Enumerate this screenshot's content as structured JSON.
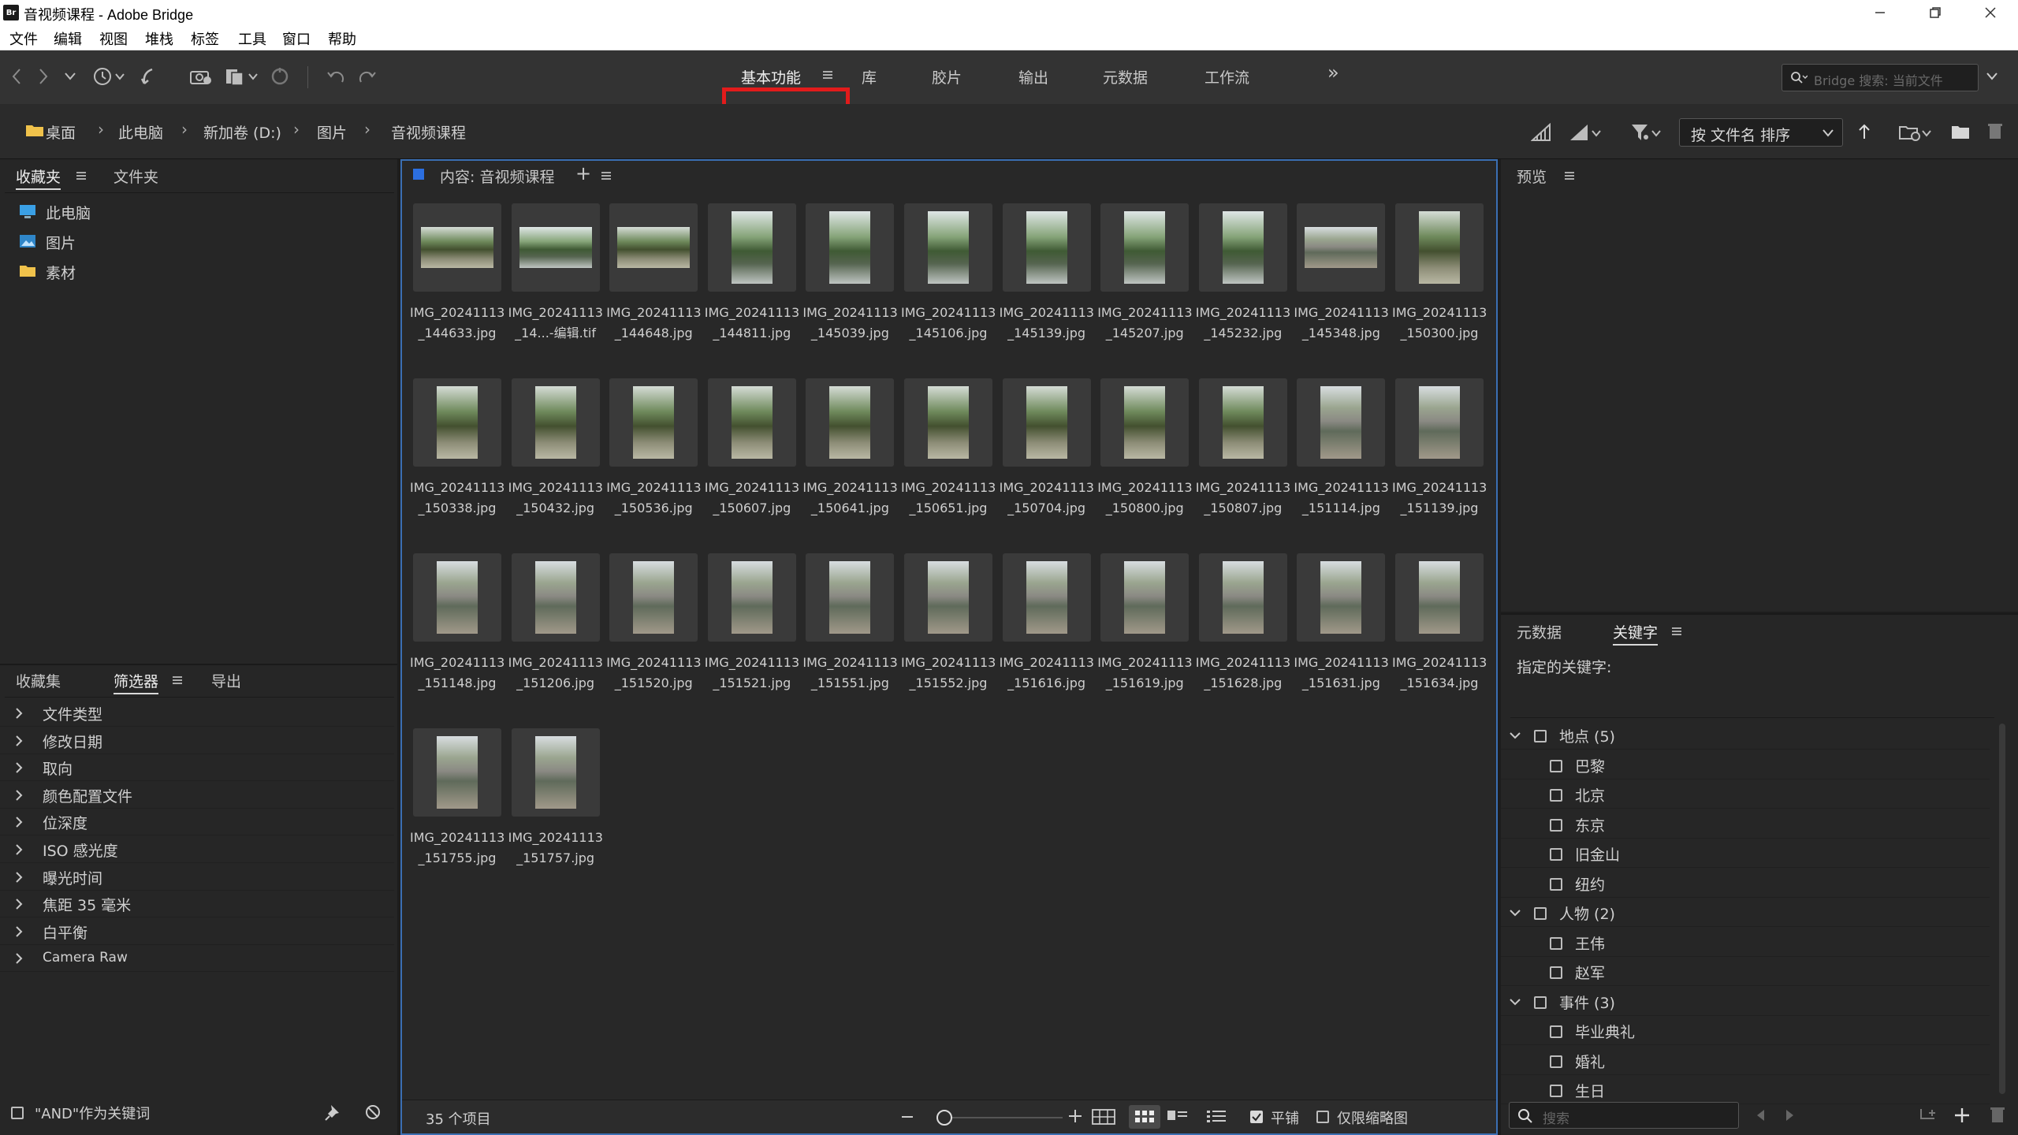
{
  "window": {
    "title": "音视频课程 - Adobe Bridge",
    "logo": "Br"
  },
  "menu": [
    "文件",
    "编辑",
    "视图",
    "堆栈",
    "标签",
    "工具",
    "窗口",
    "帮助"
  ],
  "workspaces": {
    "active": "基本功能",
    "tabs": [
      "库",
      "胶片",
      "输出",
      "元数据",
      "工作流"
    ],
    "more": "»"
  },
  "search": {
    "placeholder": "Bridge 搜索: 当前文件"
  },
  "path": [
    "桌面",
    "此电脑",
    "新加卷 (D:)",
    "图片",
    "音视频课程"
  ],
  "sort": {
    "label": "按 文件名 排序"
  },
  "left_top": {
    "tabs": [
      "收藏夹",
      "文件夹"
    ],
    "items": [
      "此电脑",
      "图片",
      "素材"
    ]
  },
  "left_bottom": {
    "tabs": [
      "收藏集",
      "筛选器",
      "导出"
    ],
    "filters": [
      "文件类型",
      "修改日期",
      "取向",
      "颜色配置文件",
      "位深度",
      "ISO 感光度",
      "曝光时间",
      "焦距 35 毫米",
      "白平衡",
      "Camera Raw"
    ],
    "footer": "\"AND\"作为关键词"
  },
  "content": {
    "label": "内容: 音视频课程",
    "files": [
      {
        "name1": "IMG_20241113",
        "name2": "_144633.jpg",
        "kind": "landscape tree"
      },
      {
        "name1": "IMG_20241113",
        "name2": "_14...-编辑.tif",
        "kind": "landscape willow"
      },
      {
        "name1": "IMG_20241113",
        "name2": "_144648.jpg",
        "kind": "landscape tree"
      },
      {
        "name1": "IMG_20241113",
        "name2": "_144811.jpg",
        "kind": "portrait willow"
      },
      {
        "name1": "IMG_20241113",
        "name2": "_145039.jpg",
        "kind": "portrait willow"
      },
      {
        "name1": "IMG_20241113",
        "name2": "_145106.jpg",
        "kind": "portrait willow"
      },
      {
        "name1": "IMG_20241113",
        "name2": "_145139.jpg",
        "kind": "portrait willow"
      },
      {
        "name1": "IMG_20241113",
        "name2": "_145207.jpg",
        "kind": "portrait willow"
      },
      {
        "name1": "IMG_20241113",
        "name2": "_145232.jpg",
        "kind": "portrait willow"
      },
      {
        "name1": "IMG_20241113",
        "name2": "_145348.jpg",
        "kind": "landscape bridge"
      },
      {
        "name1": "IMG_20241113",
        "name2": "_150300.jpg",
        "kind": "portrait tree"
      },
      {
        "name1": "IMG_20241113",
        "name2": "_150338.jpg",
        "kind": "portrait tree"
      },
      {
        "name1": "IMG_20241113",
        "name2": "_150432.jpg",
        "kind": "portrait tree"
      },
      {
        "name1": "IMG_20241113",
        "name2": "_150536.jpg",
        "kind": "portrait tree"
      },
      {
        "name1": "IMG_20241113",
        "name2": "_150607.jpg",
        "kind": "portrait tree"
      },
      {
        "name1": "IMG_20241113",
        "name2": "_150641.jpg",
        "kind": "portrait tree"
      },
      {
        "name1": "IMG_20241113",
        "name2": "_150651.jpg",
        "kind": "portrait tree"
      },
      {
        "name1": "IMG_20241113",
        "name2": "_150704.jpg",
        "kind": "portrait tree"
      },
      {
        "name1": "IMG_20241113",
        "name2": "_150800.jpg",
        "kind": "portrait tree"
      },
      {
        "name1": "IMG_20241113",
        "name2": "_150807.jpg",
        "kind": "portrait tree"
      },
      {
        "name1": "IMG_20241113",
        "name2": "_151114.jpg",
        "kind": "portrait bridge"
      },
      {
        "name1": "IMG_20241113",
        "name2": "_151139.jpg",
        "kind": "portrait bridge"
      },
      {
        "name1": "IMG_20241113",
        "name2": "_151148.jpg",
        "kind": "portrait bridge"
      },
      {
        "name1": "IMG_20241113",
        "name2": "_151206.jpg",
        "kind": "portrait bridge"
      },
      {
        "name1": "IMG_20241113",
        "name2": "_151520.jpg",
        "kind": "portrait bridge"
      },
      {
        "name1": "IMG_20241113",
        "name2": "_151521.jpg",
        "kind": "portrait bridge"
      },
      {
        "name1": "IMG_20241113",
        "name2": "_151551.jpg",
        "kind": "portrait bridge"
      },
      {
        "name1": "IMG_20241113",
        "name2": "_151552.jpg",
        "kind": "portrait bridge"
      },
      {
        "name1": "IMG_20241113",
        "name2": "_151616.jpg",
        "kind": "portrait bridge"
      },
      {
        "name1": "IMG_20241113",
        "name2": "_151619.jpg",
        "kind": "portrait bridge"
      },
      {
        "name1": "IMG_20241113",
        "name2": "_151628.jpg",
        "kind": "portrait bridge"
      },
      {
        "name1": "IMG_20241113",
        "name2": "_151631.jpg",
        "kind": "portrait bridge"
      },
      {
        "name1": "IMG_20241113",
        "name2": "_151634.jpg",
        "kind": "portrait bridge"
      },
      {
        "name1": "IMG_20241113",
        "name2": "_151755.jpg",
        "kind": "portrait bridge"
      },
      {
        "name1": "IMG_20241113",
        "name2": "_151757.jpg",
        "kind": "portrait bridge"
      }
    ],
    "status": "35 个项目",
    "tile_label": "平铺",
    "thumbs_only_label": "仅限缩略图"
  },
  "preview": {
    "label": "预览"
  },
  "keywords": {
    "tabs": [
      "元数据",
      "关键字"
    ],
    "assigned_label": "指定的关键字:",
    "groups": [
      {
        "label": "地点 (5)",
        "items": [
          "巴黎",
          "北京",
          "东京",
          "旧金山",
          "纽约"
        ]
      },
      {
        "label": "人物 (2)",
        "items": [
          "王伟",
          "赵军"
        ]
      },
      {
        "label": "事件 (3)",
        "items": [
          "毕业典礼",
          "婚礼",
          "生日"
        ]
      }
    ],
    "search_placeholder": "搜索"
  },
  "colors": {
    "accent_blue": "#3b6fb3",
    "highlight_red": "#e21b1b"
  }
}
